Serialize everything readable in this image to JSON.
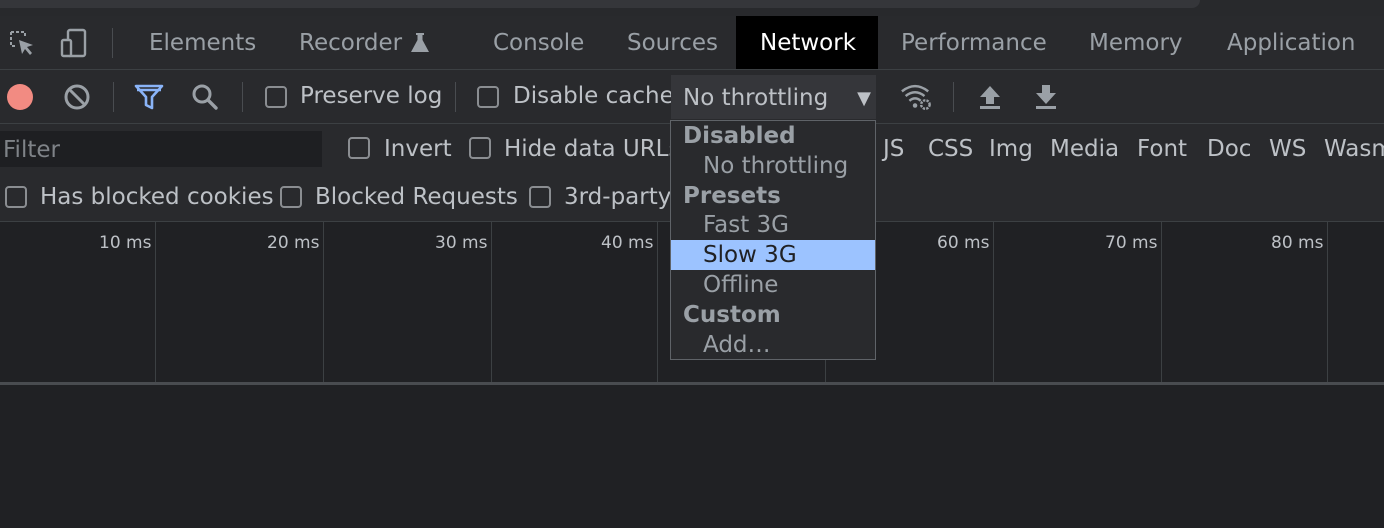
{
  "tabs": [
    {
      "label": "Elements"
    },
    {
      "label": "Recorder"
    },
    {
      "label": "Console"
    },
    {
      "label": "Sources"
    },
    {
      "label": "Network"
    },
    {
      "label": "Performance"
    },
    {
      "label": "Memory"
    },
    {
      "label": "Application"
    }
  ],
  "active_tab": "Network",
  "toolbar": {
    "preserve_log_label": "Preserve log",
    "disable_cache_label": "Disable cache",
    "throttling_value": "No throttling",
    "record_color": "#f28b82",
    "filter_active_color": "#8ab4f8"
  },
  "filter": {
    "placeholder": "Filter",
    "invert_label": "Invert",
    "hide_data_urls_label": "Hide data URLs",
    "types": [
      "JS",
      "CSS",
      "Img",
      "Media",
      "Font",
      "Doc",
      "WS",
      "Wasm"
    ]
  },
  "cookie_row": {
    "has_blocked_cookies_label": "Has blocked cookies",
    "blocked_requests_label": "Blocked Requests",
    "third_party_label": "3rd-party"
  },
  "timeline": {
    "ticks": [
      "10 ms",
      "20 ms",
      "30 ms",
      "40 ms",
      "60 ms",
      "70 ms",
      "80 ms"
    ]
  },
  "throttling_menu": {
    "items": [
      {
        "kind": "header",
        "label": "Disabled"
      },
      {
        "kind": "option",
        "label": "No throttling"
      },
      {
        "kind": "header",
        "label": "Presets"
      },
      {
        "kind": "option",
        "label": "Fast 3G"
      },
      {
        "kind": "option",
        "label": "Slow 3G",
        "selected": true
      },
      {
        "kind": "option",
        "label": "Offline"
      },
      {
        "kind": "header",
        "label": "Custom"
      },
      {
        "kind": "option",
        "label": "Add…"
      }
    ],
    "highlight_color": "#9cc3ff"
  }
}
